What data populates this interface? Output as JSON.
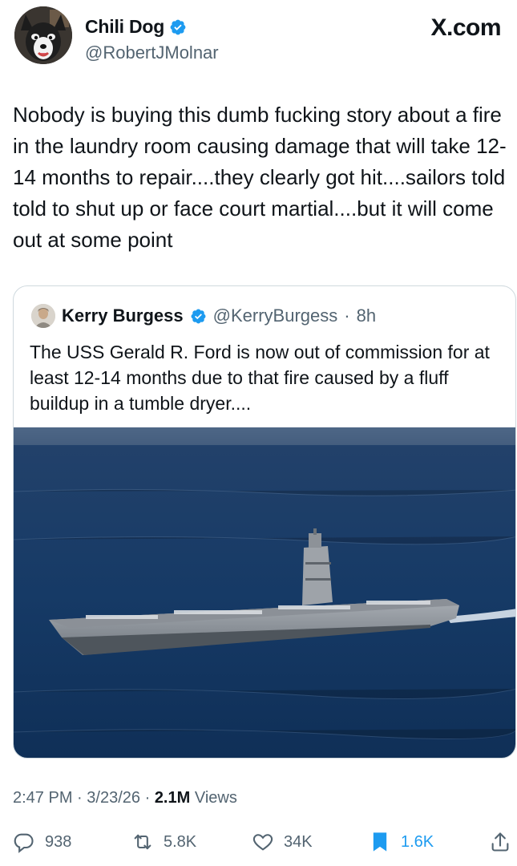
{
  "brand": "X.com",
  "author": {
    "name": "Chili Dog",
    "handle": "@RobertJMolnar",
    "verified": true
  },
  "tweet_text": "Nobody is buying this dumb fucking story about a fire in the laundry room causing damage that will take 12-14 months to repair....they clearly got hit....sailors told told to shut up or face court martial....but it will come out at some point",
  "quoted": {
    "name": "Kerry Burgess",
    "handle": "@KerryBurgess",
    "separator": "·",
    "time": "8h",
    "text": "The USS Gerald R. Ford is now out of commission for at least 12-14 months due to that fire caused by a fluff buildup in a tumble dryer....",
    "image_desc_icon": "aircraft-carrier-photo"
  },
  "meta": {
    "time": "2:47 PM",
    "sep1": "·",
    "date": "3/23/26",
    "sep2": "·",
    "views_count": "2.1M",
    "views_label": "Views"
  },
  "actions": {
    "replies": "938",
    "reposts": "5.8K",
    "likes": "34K",
    "bookmarks": "1.6K"
  },
  "colors": {
    "verified": "#1d9bf0",
    "secondary_text": "#536471",
    "bookmark_active": "#1d9bf0"
  }
}
